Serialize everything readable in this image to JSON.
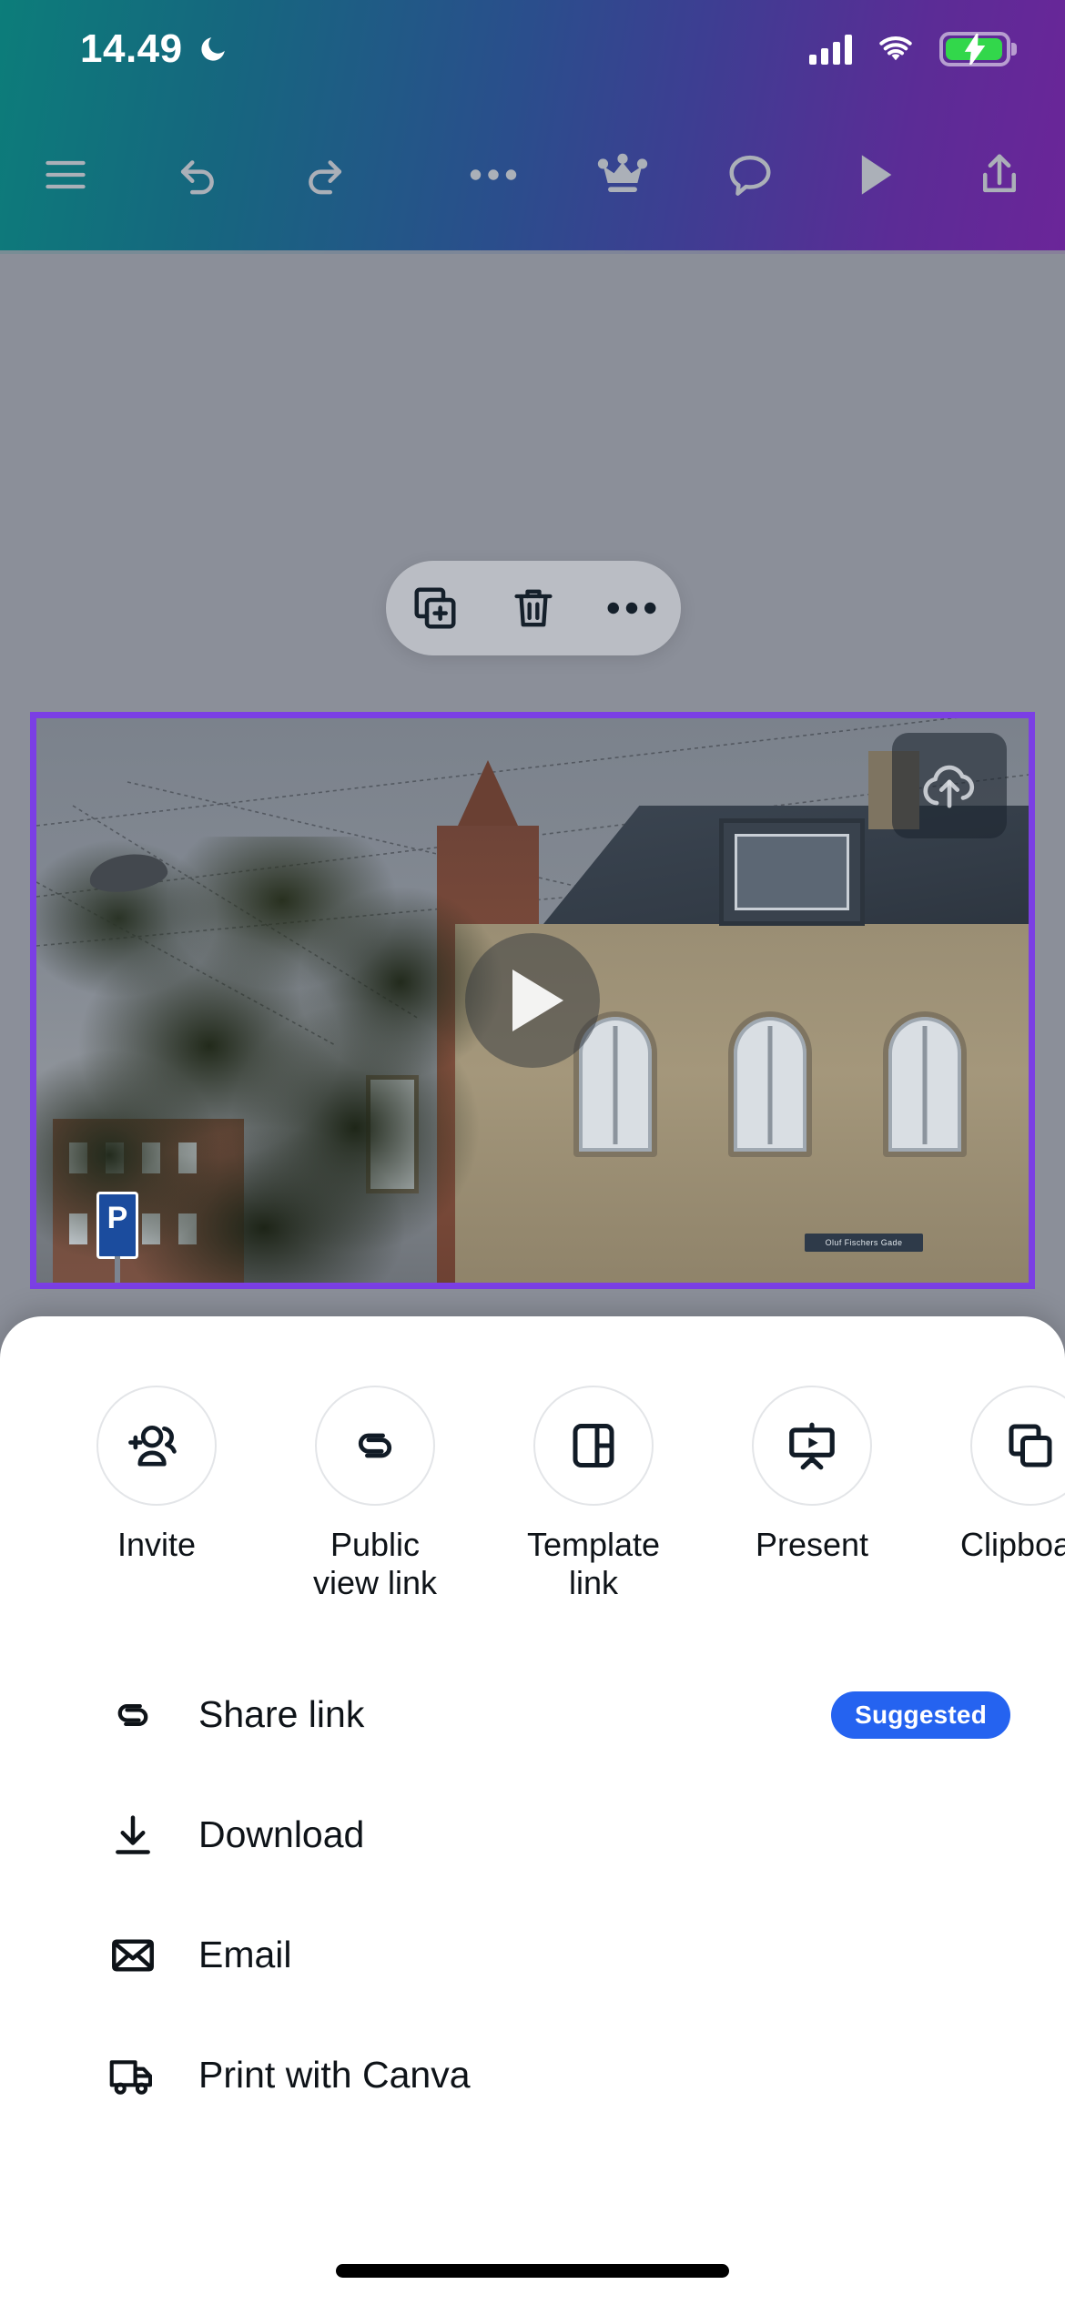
{
  "status_bar": {
    "time": "14.49",
    "dnd_icon": "crescent-moon-icon",
    "signal_icon": "cellular-signal-icon",
    "wifi_icon": "wifi-icon",
    "battery_icon": "battery-charging-icon",
    "battery_color": "#32D74B"
  },
  "toolbar": {
    "menu_icon": "hamburger-menu-icon",
    "undo_icon": "undo-icon",
    "redo_icon": "redo-icon",
    "more_icon": "more-horizontal-icon",
    "pro_icon": "crown-icon",
    "comment_icon": "comment-bubble-icon",
    "play_icon": "play-icon",
    "share_icon": "share-upload-icon",
    "icon_color": "#ABB0B8"
  },
  "element_toolbar": {
    "duplicate_icon": "duplicate-icon",
    "delete_icon": "trash-icon",
    "more_icon": "more-horizontal-icon"
  },
  "canvas": {
    "selection_color": "#7B3FE4",
    "media_type": "video",
    "play_overlay_icon": "play-triangle-icon",
    "cloud_badge_icon": "cloud-upload-icon",
    "photo_sign_text": "P",
    "photo_shop_sign_text": "Oluf Fischers Gade"
  },
  "share_sheet": {
    "quick_actions": [
      {
        "label": "Invite",
        "icon": "add-people-icon"
      },
      {
        "label": "Public\nview link",
        "icon": "link-icon"
      },
      {
        "label": "Template\nlink",
        "icon": "template-layout-icon"
      },
      {
        "label": "Present",
        "icon": "present-screen-icon"
      },
      {
        "label": "Clipboard",
        "icon": "copy-icon"
      }
    ],
    "rows": [
      {
        "label": "Share link",
        "icon": "link-icon",
        "badge": "Suggested"
      },
      {
        "label": "Download",
        "icon": "download-icon",
        "badge": ""
      },
      {
        "label": "Email",
        "icon": "envelope-icon",
        "badge": ""
      },
      {
        "label": "Print with Canva",
        "icon": "delivery-truck-icon",
        "badge": ""
      }
    ],
    "badge_color": "#2563F0"
  }
}
